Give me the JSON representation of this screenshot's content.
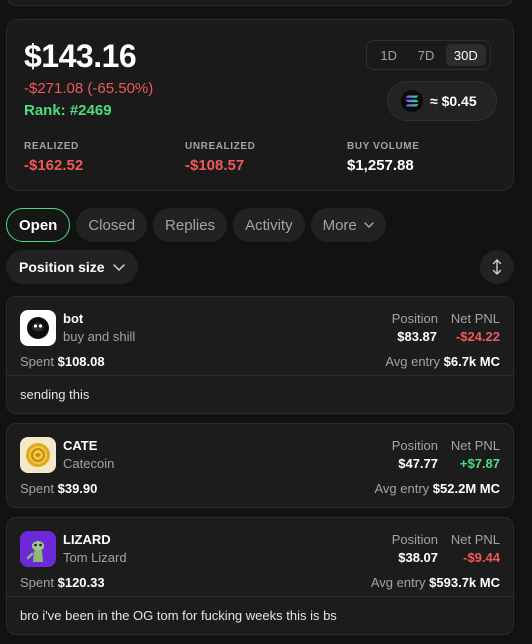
{
  "summary": {
    "balance": "$143.16",
    "pnl_total": "-$271.08 (-65.50%)",
    "rank": "Rank: #2469",
    "ranges": [
      "1D",
      "7D",
      "30D"
    ],
    "active_range": "30D",
    "sol_price": "≈ $0.45",
    "stats": [
      {
        "label": "REALIZED",
        "value": "-$162.52"
      },
      {
        "label": "UNREALIZED",
        "value": "-$108.57"
      },
      {
        "label": "BUY VOLUME",
        "value": "$1,257.88"
      }
    ]
  },
  "tabs": [
    "Open",
    "Closed",
    "Replies",
    "Activity",
    "More"
  ],
  "filter": {
    "label": "Position size"
  },
  "positions": [
    {
      "ticker": "bot",
      "name": "buy and shill",
      "position_label": "Position",
      "position": "$83.87",
      "pnl_label": "Net PNL",
      "pnl": "-$24.22",
      "spent_label": "Spent",
      "spent": "$108.08",
      "avg_label": "Avg entry",
      "avg": "$6.7k MC",
      "comment": "sending this"
    },
    {
      "ticker": "CATE",
      "name": "Catecoin",
      "position_label": "Position",
      "position": "$47.77",
      "pnl_label": "Net PNL",
      "pnl": "+$7.87",
      "spent_label": "Spent",
      "spent": "$39.90",
      "avg_label": "Avg entry",
      "avg": "$52.2M MC",
      "comment": ""
    },
    {
      "ticker": "LIZARD",
      "name": "Tom Lizard",
      "position_label": "Position",
      "position": "$38.07",
      "pnl_label": "Net PNL",
      "pnl": "-$9.44",
      "spent_label": "Spent",
      "spent": "$120.33",
      "avg_label": "Avg entry",
      "avg": "$593.7k MC",
      "comment": "bro i've been in the OG tom for fucking weeks this is bs"
    }
  ],
  "icons": {
    "sol": "solana-icon",
    "chevron": "chevron-down-icon",
    "sort": "sort-arrows-icon",
    "bot": "bot-token-icon",
    "cate": "cate-token-icon",
    "lizard": "lizard-token-icon"
  },
  "colors": {
    "accent_green": "#4ade80",
    "loss_red": "#f0585b",
    "background": "#121212",
    "card": "#1a1a1a"
  }
}
